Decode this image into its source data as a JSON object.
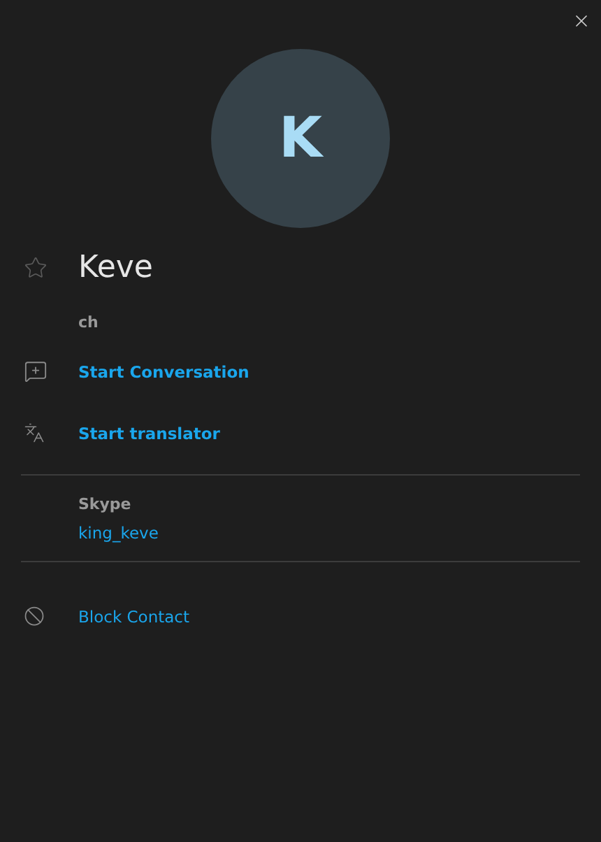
{
  "avatar": {
    "initial": "K"
  },
  "contact": {
    "name": "Keve",
    "favorite": false,
    "subtitle": "ch"
  },
  "actions": [
    {
      "kind": "conversation",
      "label": "Start Conversation"
    },
    {
      "kind": "translator",
      "label": "Start translator"
    }
  ],
  "accounts": [
    {
      "service": "Skype",
      "handle": "king_keve"
    }
  ],
  "block": {
    "label": "Block Contact"
  }
}
